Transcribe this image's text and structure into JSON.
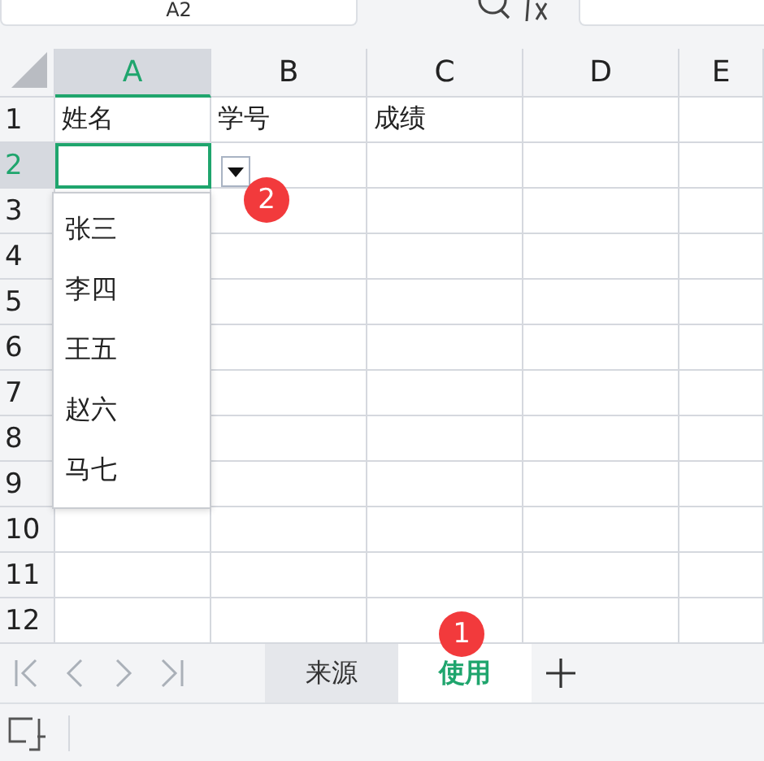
{
  "name_box": "A2",
  "columns": [
    {
      "label": "A",
      "selected": true
    },
    {
      "label": "B",
      "selected": false
    },
    {
      "label": "C",
      "selected": false
    },
    {
      "label": "D",
      "selected": false
    },
    {
      "label": "E",
      "selected": false
    }
  ],
  "rows": [
    {
      "label": "1",
      "selected": false,
      "cells": [
        "姓名",
        "学号",
        "成绩"
      ]
    },
    {
      "label": "2",
      "selected": true
    },
    {
      "label": "3",
      "selected": false
    },
    {
      "label": "4",
      "selected": false
    },
    {
      "label": "5",
      "selected": false
    },
    {
      "label": "6",
      "selected": false
    },
    {
      "label": "7",
      "selected": false
    },
    {
      "label": "8",
      "selected": false
    },
    {
      "label": "9",
      "selected": false
    },
    {
      "label": "10",
      "selected": false
    },
    {
      "label": "11",
      "selected": false
    },
    {
      "label": "12",
      "selected": false
    }
  ],
  "dropdown": {
    "items": [
      "张三",
      "李四",
      "王五",
      "赵六",
      "马七"
    ]
  },
  "badges": [
    {
      "label": "2"
    },
    {
      "label": "1"
    }
  ],
  "sheet_tabs": [
    {
      "label": "来源",
      "selected": false
    },
    {
      "label": "使用",
      "selected": true
    }
  ]
}
